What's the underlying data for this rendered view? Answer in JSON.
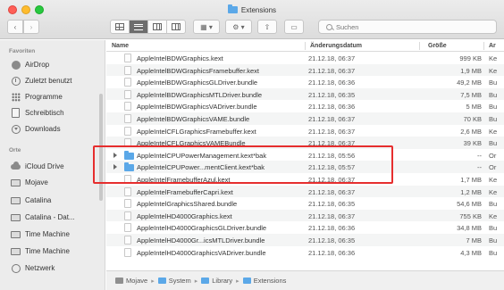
{
  "window": {
    "title": "Extensions"
  },
  "toolbar": {
    "back_icon": "chevron-left-icon",
    "forward_icon": "chevron-right-icon",
    "search_placeholder": "Suchen"
  },
  "sidebar": {
    "favorites_label": "Favoriten",
    "favorites": [
      {
        "label": "AirDrop",
        "icon": "airdrop-icon"
      },
      {
        "label": "Zuletzt benutzt",
        "icon": "recents-icon"
      },
      {
        "label": "Programme",
        "icon": "applications-icon"
      },
      {
        "label": "Schreibtisch",
        "icon": "desktop-icon"
      },
      {
        "label": "Downloads",
        "icon": "downloads-icon"
      }
    ],
    "locations_label": "Orte",
    "locations": [
      {
        "label": "iCloud Drive",
        "icon": "cloud-icon"
      },
      {
        "label": "Mojave",
        "icon": "disk-icon"
      },
      {
        "label": "Catalina",
        "icon": "disk-icon"
      },
      {
        "label": "Catalina - Dat...",
        "icon": "disk-icon"
      },
      {
        "label": "Time Machine",
        "icon": "disk-icon"
      },
      {
        "label": "Time Machine",
        "icon": "disk-icon"
      },
      {
        "label": "Netzwerk",
        "icon": "globe-icon"
      }
    ]
  },
  "columns": {
    "name": "Name",
    "date": "Änderungsdatum",
    "size": "Größe",
    "kind": "Ar"
  },
  "files": [
    {
      "name": "AppleIntelBDWGraphics.kext",
      "date": "21.12.18, 06:37",
      "size": "999 KB",
      "kind": "Ke",
      "type": "file"
    },
    {
      "name": "AppleIntelBDWGraphicsFramebuffer.kext",
      "date": "21.12.18, 06:37",
      "size": "1,9 MB",
      "kind": "Ke",
      "type": "file"
    },
    {
      "name": "AppleIntelBDWGraphicsGLDriver.bundle",
      "date": "21.12.18, 06:36",
      "size": "49,2 MB",
      "kind": "Bu",
      "type": "file"
    },
    {
      "name": "AppleIntelBDWGraphicsMTLDriver.bundle",
      "date": "21.12.18, 06:35",
      "size": "7,5 MB",
      "kind": "Bu",
      "type": "file"
    },
    {
      "name": "AppleIntelBDWGraphicsVADriver.bundle",
      "date": "21.12.18, 06:36",
      "size": "5 MB",
      "kind": "Bu",
      "type": "file"
    },
    {
      "name": "AppleIntelBDWGraphicsVAME.bundle",
      "date": "21.12.18, 06:37",
      "size": "70 KB",
      "kind": "Bu",
      "type": "file"
    },
    {
      "name": "AppleIntelCFLGraphicsFramebuffer.kext",
      "date": "21.12.18, 06:37",
      "size": "2,6 MB",
      "kind": "Ke",
      "type": "file"
    },
    {
      "name": "AppleIntelCFLGraphicsVAMEBundle",
      "date": "21.12.18, 06:37",
      "size": "39 KB",
      "kind": "Bu",
      "type": "file"
    },
    {
      "name": "AppleIntelCPUPowerManagement.kext*bak",
      "date": "21.12.18, 05:56",
      "size": "--",
      "kind": "Or",
      "type": "folder"
    },
    {
      "name": "AppleIntelCPUPower...mentClient.kext*bak",
      "date": "21.12.18, 05:57",
      "size": "--",
      "kind": "Or",
      "type": "folder"
    },
    {
      "name": "AppleIntelFramebufferAzul.kext",
      "date": "21.12.18, 06:37",
      "size": "1,7 MB",
      "kind": "Ke",
      "type": "file"
    },
    {
      "name": "AppleIntelFramebufferCapri.kext",
      "date": "21.12.18, 06:37",
      "size": "1,2 MB",
      "kind": "Ke",
      "type": "file"
    },
    {
      "name": "AppleIntelGraphicsShared.bundle",
      "date": "21.12.18, 06:35",
      "size": "54,6 MB",
      "kind": "Bu",
      "type": "file"
    },
    {
      "name": "AppleIntelHD4000Graphics.kext",
      "date": "21.12.18, 06:37",
      "size": "755 KB",
      "kind": "Ke",
      "type": "file"
    },
    {
      "name": "AppleIntelHD4000GraphicsGLDriver.bundle",
      "date": "21.12.18, 06:36",
      "size": "34,8 MB",
      "kind": "Bu",
      "type": "file"
    },
    {
      "name": "AppleIntelHD4000Gr...icsMTLDriver.bundle",
      "date": "21.12.18, 06:35",
      "size": "7 MB",
      "kind": "Bu",
      "type": "file"
    },
    {
      "name": "AppleIntelHD4000GraphicsVADriver.bundle",
      "date": "21.12.18, 06:36",
      "size": "4,3 MB",
      "kind": "Bu",
      "type": "file"
    }
  ],
  "pathbar": [
    "Mojave",
    "System",
    "Library",
    "Extensions"
  ],
  "colors": {
    "highlight": "#e62e2e",
    "folder_blue": "#5ba8e8"
  }
}
